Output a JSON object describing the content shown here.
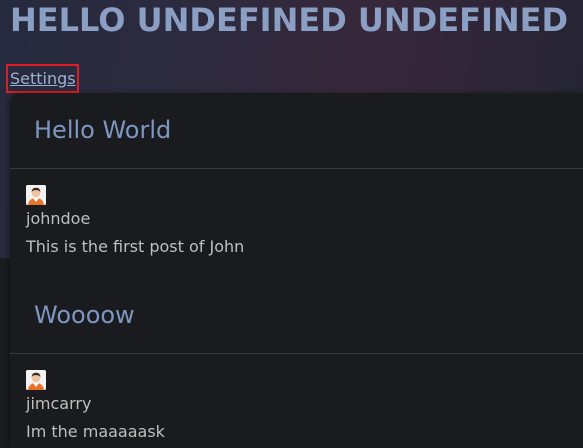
{
  "page": {
    "title": "HELLO UNDEFINED UNDEFINED"
  },
  "nav": {
    "settings_label": "Settings"
  },
  "posts": [
    {
      "title": "Hello World",
      "author": "johndoe",
      "body": "This is the first post of John",
      "avatar_icon": "user-avatar-icon"
    },
    {
      "title": "Woooow",
      "author": "jimcarry",
      "body": "Im the maaaaask",
      "avatar_icon": "user-avatar-icon"
    }
  ],
  "colors": {
    "title": "#8a9fc3",
    "post_title": "#7e96c2",
    "link": "#9db0d2",
    "highlight_border": "#e01b24",
    "text": "#bfbfbf",
    "card_bg": "#1a1b1e"
  }
}
